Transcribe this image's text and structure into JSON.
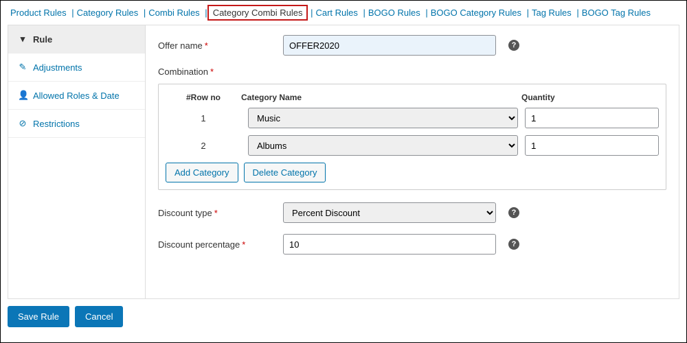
{
  "tabs": {
    "items": [
      {
        "label": "Product Rules",
        "active": false
      },
      {
        "label": "Category Rules",
        "active": false
      },
      {
        "label": "Combi Rules",
        "active": false
      },
      {
        "label": "Category Combi Rules",
        "active": true
      },
      {
        "label": "Cart Rules",
        "active": false
      },
      {
        "label": "BOGO Rules",
        "active": false
      },
      {
        "label": "BOGO Category Rules",
        "active": false
      },
      {
        "label": "Tag Rules",
        "active": false
      },
      {
        "label": "BOGO Tag Rules",
        "active": false
      }
    ]
  },
  "sidebar": {
    "items": [
      {
        "label": "Rule",
        "icon": "filter",
        "active": true
      },
      {
        "label": "Adjustments",
        "icon": "pencil",
        "active": false
      },
      {
        "label": "Allowed Roles & Date",
        "icon": "user",
        "active": false
      },
      {
        "label": "Restrictions",
        "icon": "ban",
        "active": false
      }
    ]
  },
  "form": {
    "offer_name_label": "Offer name",
    "offer_name_value": "OFFER2020",
    "combination_label": "Combination",
    "combi_head_row": "#Row no",
    "combi_head_category": "Category Name",
    "combi_head_quantity": "Quantity",
    "combi_rows": [
      {
        "row": "1",
        "category": "Music",
        "quantity": "1"
      },
      {
        "row": "2",
        "category": "Albums",
        "quantity": "1"
      }
    ],
    "add_category_label": "Add Category",
    "delete_category_label": "Delete Category",
    "discount_type_label": "Discount type",
    "discount_type_value": "Percent Discount",
    "discount_percentage_label": "Discount percentage",
    "discount_percentage_value": "10"
  },
  "footer": {
    "save_label": "Save Rule",
    "cancel_label": "Cancel"
  }
}
